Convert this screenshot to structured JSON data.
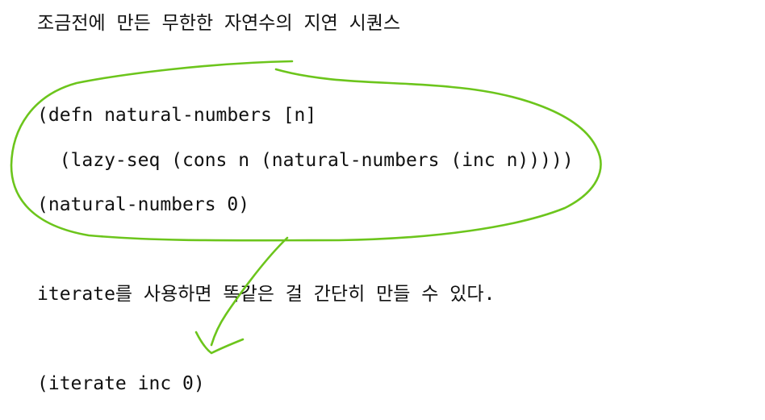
{
  "lines": {
    "heading": "조금전에 만든 무한한 자연수의 지연 시퀀스",
    "code_defn": "(defn natural-numbers [n]",
    "code_body": "  (lazy-seq (cons n (natural-numbers (inc n)))))",
    "code_call": "(natural-numbers 0)",
    "note": "iterate를 사용하면 똑같은 걸 간단히 만들 수 있다.",
    "code_iterate": "(iterate inc 0)"
  },
  "annotation": {
    "ink_color": "#6cc51c",
    "shapes": [
      "circle-around-code",
      "arrow-down-left"
    ]
  }
}
